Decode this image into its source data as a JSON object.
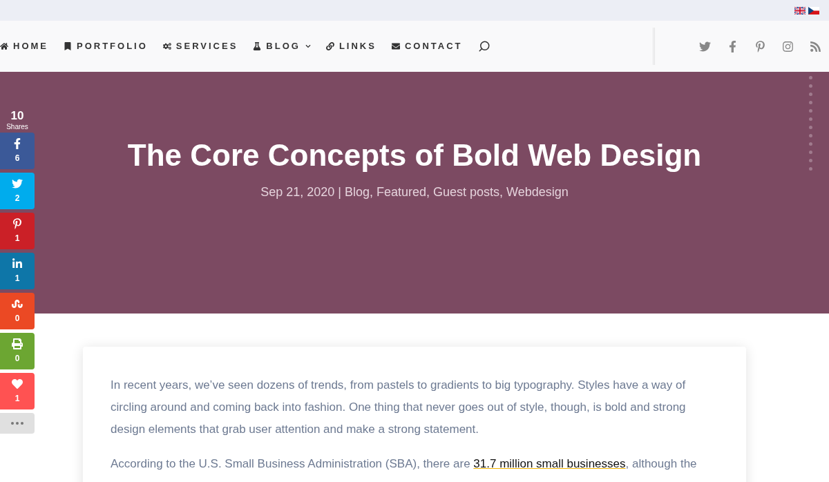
{
  "nav": {
    "items": [
      {
        "label": "HOME",
        "dropdown": false
      },
      {
        "label": "PORTFOLIO",
        "dropdown": false
      },
      {
        "label": "SERVICES",
        "dropdown": false
      },
      {
        "label": "BLOG",
        "dropdown": true
      },
      {
        "label": "LINKS",
        "dropdown": false
      },
      {
        "label": "CONTACT",
        "dropdown": false
      }
    ]
  },
  "share": {
    "total": "10",
    "label": "Shares",
    "buttons": [
      {
        "kind": "facebook",
        "count": "6",
        "color": "#3b5998"
      },
      {
        "kind": "twitter",
        "count": "2",
        "color": "#00aced"
      },
      {
        "kind": "pinterest",
        "count": "1",
        "color": "#cb2027"
      },
      {
        "kind": "linkedin",
        "count": "1",
        "color": "#0e76a8"
      },
      {
        "kind": "stumbleupon",
        "count": "0",
        "color": "#eb4924"
      },
      {
        "kind": "print",
        "count": "0",
        "color": "#6ca632"
      },
      {
        "kind": "love",
        "count": "1",
        "color": "#ff5252"
      }
    ]
  },
  "hero": {
    "title": "The Core Concepts of Bold Web Design",
    "meta": "Sep 21, 2020 | Blog, Featured, Guest posts, Webdesign"
  },
  "article": {
    "paragraphs": [
      {
        "text": "In recent years, we’ve seen dozens of trends, from pastels to gradients to big typography. Styles have a way of circling around and coming back into fashion. One thing that never goes out of style, though, is bold and strong design elements that grab user attention and make a strong statement."
      },
      {
        "text": "According to the U.S. Small Business Administration (SBA), there are",
        "link": "31.7 million small businesses",
        "after": ", although the"
      }
    ]
  }
}
